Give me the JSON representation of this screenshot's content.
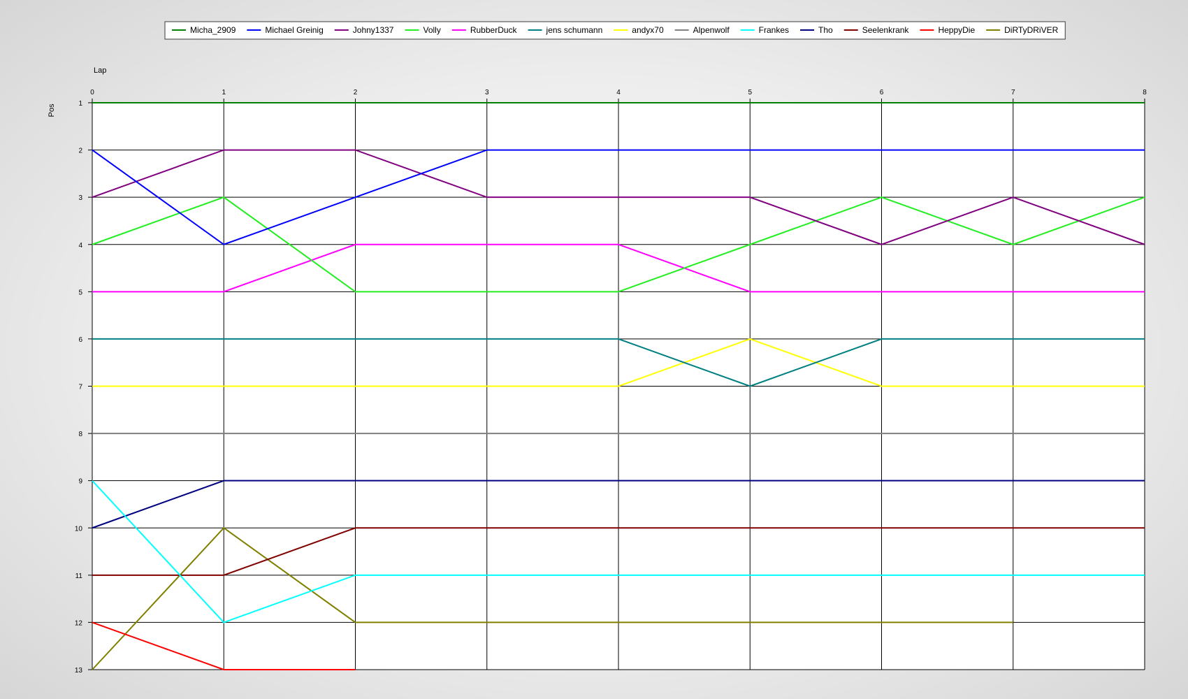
{
  "chart_data": {
    "type": "line",
    "xlabel": "Lap",
    "ylabel": "Pos",
    "x": [
      0,
      1,
      2,
      3,
      4,
      5,
      6,
      7,
      8
    ],
    "xlim": [
      0,
      8
    ],
    "ylim": [
      1,
      13
    ],
    "y_inverted": true,
    "y_ticks": [
      1,
      2,
      3,
      4,
      5,
      6,
      7,
      8,
      9,
      10,
      11,
      12,
      13
    ],
    "grid": true,
    "legend_position": "top-center",
    "series": [
      {
        "name": "Micha_2909",
        "color": "#008000",
        "values": [
          1,
          1,
          1,
          1,
          1,
          1,
          1,
          1,
          1
        ]
      },
      {
        "name": "Michael Greinig",
        "color": "#0000ff",
        "values": [
          2,
          4,
          3,
          2,
          2,
          2,
          2,
          2,
          2
        ]
      },
      {
        "name": "Johny1337",
        "color": "#800080",
        "values": [
          3,
          2,
          2,
          3,
          3,
          3,
          4,
          3,
          4
        ]
      },
      {
        "name": "Volly",
        "color": "#22ee22",
        "values": [
          4,
          3,
          5,
          5,
          5,
          4,
          3,
          4,
          3
        ]
      },
      {
        "name": "RubberDuck",
        "color": "#ff00ff",
        "values": [
          5,
          5,
          4,
          4,
          4,
          5,
          5,
          5,
          5
        ]
      },
      {
        "name": "jens  schumann",
        "color": "#008080",
        "values": [
          6,
          6,
          6,
          6,
          6,
          7,
          6,
          6,
          6
        ]
      },
      {
        "name": "andyx70",
        "color": "#ffff00",
        "values": [
          7,
          7,
          7,
          7,
          7,
          6,
          7,
          7,
          7
        ]
      },
      {
        "name": "Alpenwolf",
        "color": "#808080",
        "values": [
          8,
          8,
          8,
          8,
          8,
          8,
          8,
          8,
          8
        ]
      },
      {
        "name": "Frankes",
        "color": "#00ffff",
        "values": [
          9,
          12,
          11,
          11,
          11,
          11,
          11,
          11,
          11
        ]
      },
      {
        "name": "Tho",
        "color": "#000080",
        "values": [
          10,
          9,
          9,
          9,
          9,
          9,
          9,
          9,
          9
        ]
      },
      {
        "name": "Seelenkrank",
        "color": "#800000",
        "values": [
          11,
          11,
          10,
          10,
          10,
          10,
          10,
          10,
          10
        ]
      },
      {
        "name": "HeppyDie",
        "color": "#ff0000",
        "values": [
          12,
          13,
          13,
          null,
          null,
          null,
          null,
          null,
          null
        ]
      },
      {
        "name": "DiRTyDRiVER",
        "color": "#808000",
        "values": [
          13,
          10,
          12,
          12,
          12,
          12,
          12,
          12,
          null
        ]
      }
    ]
  }
}
